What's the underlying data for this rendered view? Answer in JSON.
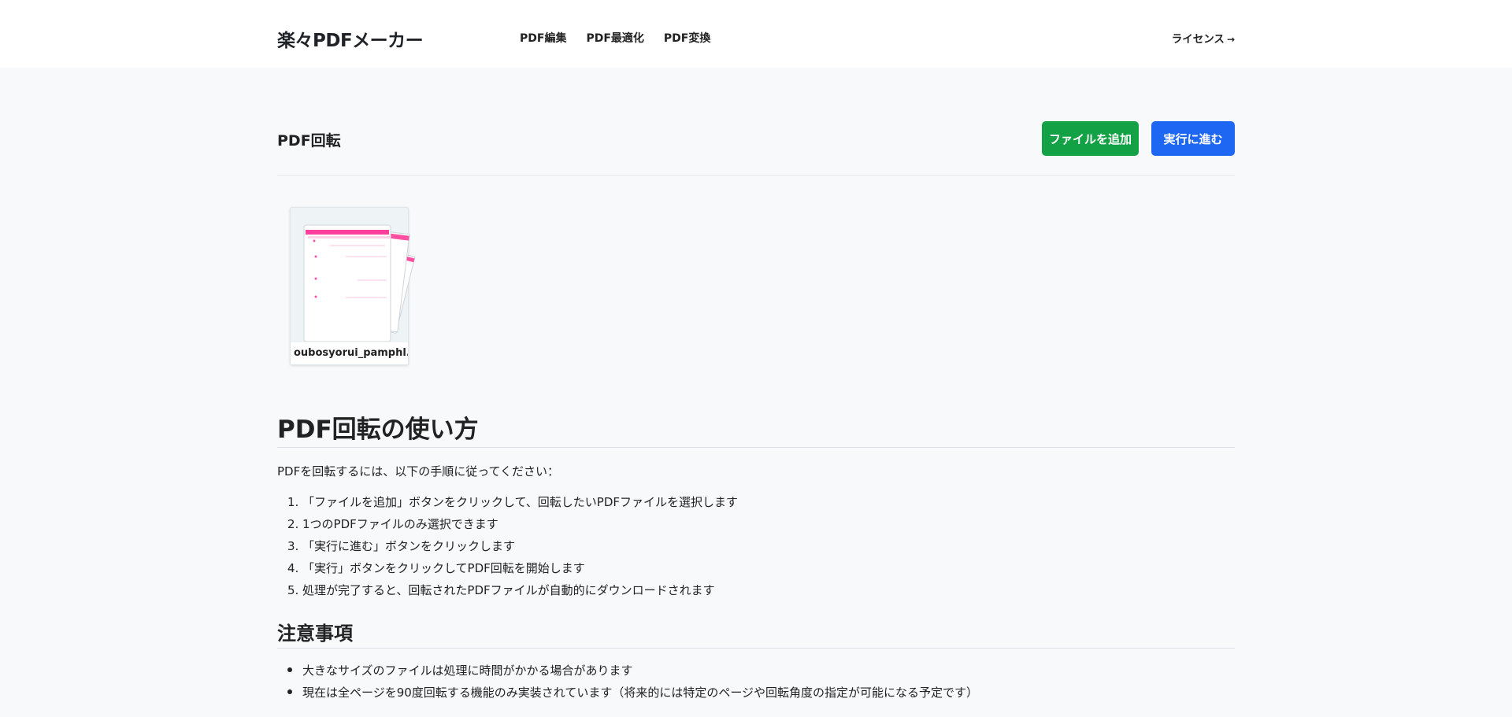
{
  "header": {
    "logo": "楽々PDFメーカー",
    "nav": [
      "PDF編集",
      "PDF最適化",
      "PDF変換"
    ],
    "license_label": "ライセンス",
    "license_icon": "arrow-right-icon"
  },
  "toolbar": {
    "title": "PDF回転",
    "add_file_label": "ファイルを追加",
    "proceed_label": "実行に進む",
    "add_color": "#12a144",
    "proceed_color": "#1e67f3"
  },
  "files": [
    {
      "name": "oubosyorui_pamphl..."
    }
  ],
  "help": {
    "title": "PDF回転の使い方",
    "intro": "PDFを回転するには、以下の手順に従ってください：",
    "steps": [
      {
        "num": "1.",
        "text": "「ファイルを追加」ボタンをクリックして、回転したいPDFファイルを選択します"
      },
      {
        "num": "2.",
        "text": "1つのPDFファイルのみ選択できます"
      },
      {
        "num": "3.",
        "text": "「実行に進む」ボタンをクリックします"
      },
      {
        "num": "4.",
        "text": "「実行」ボタンをクリックしてPDF回転を開始します"
      },
      {
        "num": "5.",
        "text": "処理が完了すると、回転されたPDFファイルが自動的にダウンロードされます"
      }
    ],
    "notes_title": "注意事項",
    "notes": [
      "大きなサイズのファイルは処理に時間がかかる場合があります",
      "現在は全ページを90度回転する機能のみ実装されています（将来的には特定のページや回転角度の指定が可能になる予定です）"
    ]
  }
}
